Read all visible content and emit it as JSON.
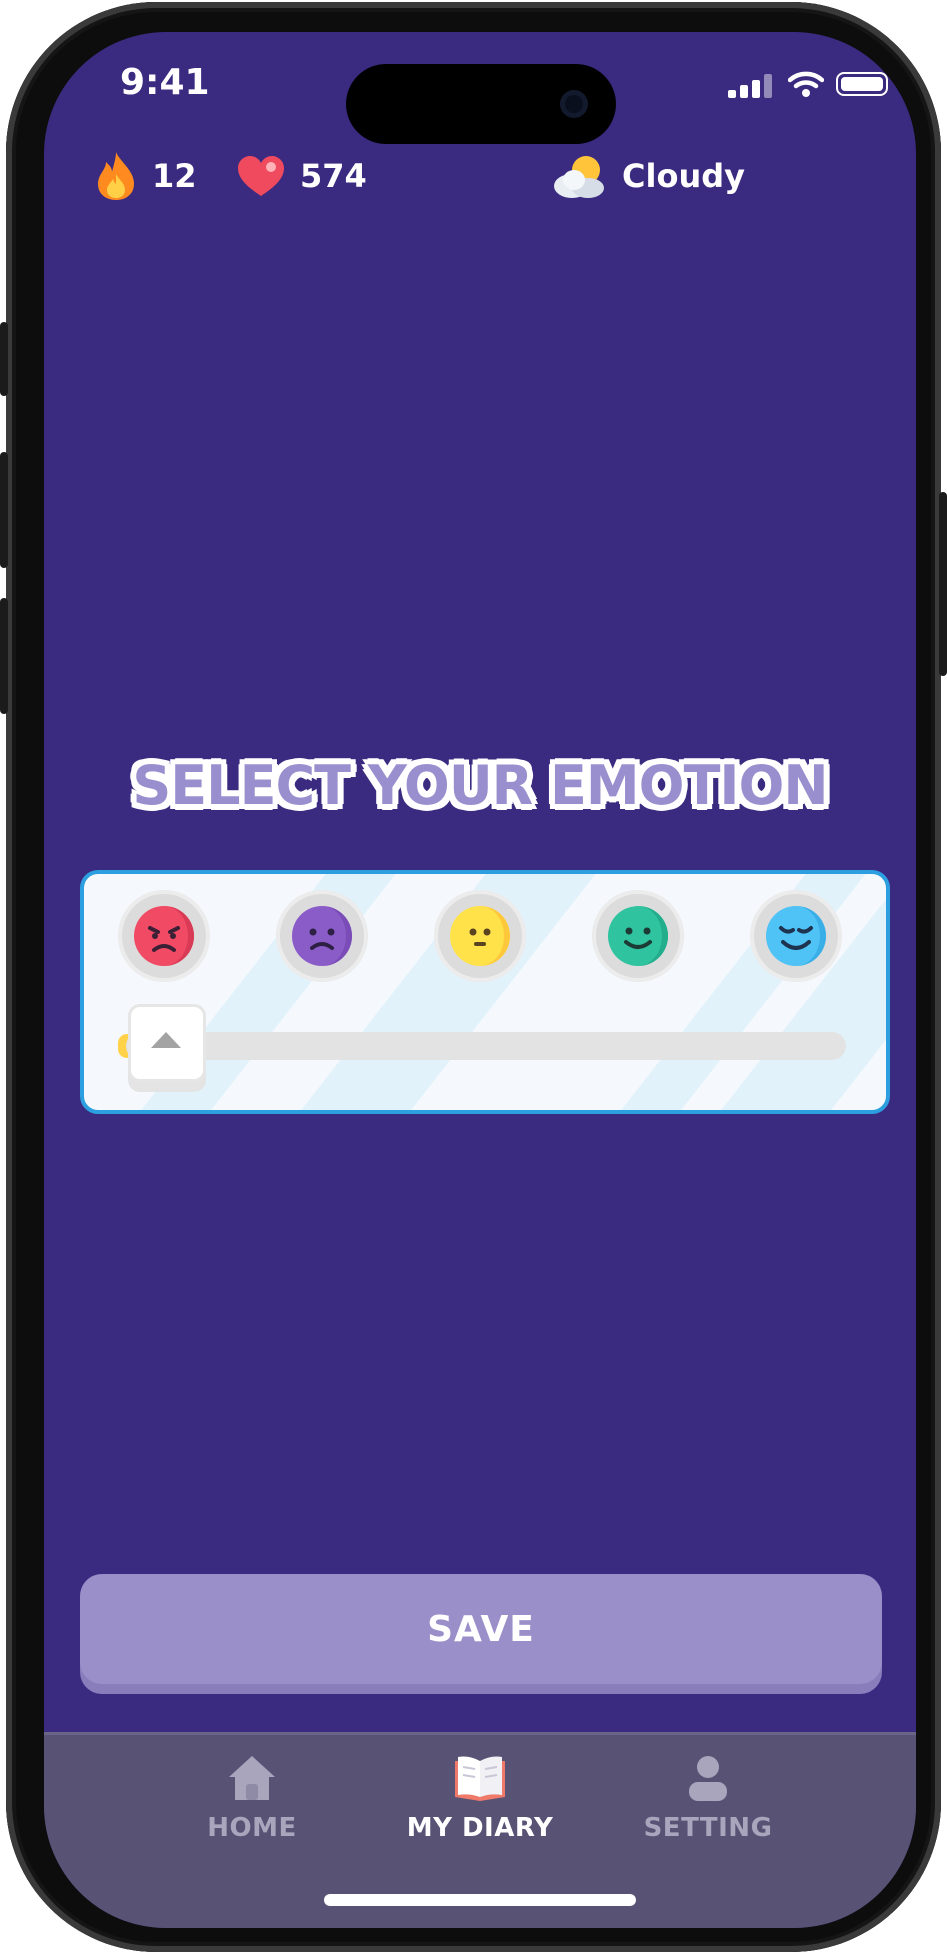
{
  "status_bar": {
    "time": "9:41"
  },
  "header": {
    "streak_count": "12",
    "hearts_count": "574",
    "weather_label": "Cloudy"
  },
  "emotion_picker": {
    "title": "SELECT YOUR EMOTION",
    "options": [
      {
        "name": "angry",
        "color": "#f04a64"
      },
      {
        "name": "sad",
        "color": "#8a5cc8"
      },
      {
        "name": "neutral",
        "color": "#ffe14a"
      },
      {
        "name": "happy",
        "color": "#2fc3a0"
      },
      {
        "name": "very-happy",
        "color": "#4fc3f5"
      }
    ],
    "selected_index": 0
  },
  "actions": {
    "save_label": "SAVE"
  },
  "tabs": [
    {
      "label": "HOME",
      "icon": "home-icon",
      "active": false
    },
    {
      "label": "MY DIARY",
      "icon": "book-icon",
      "active": true
    },
    {
      "label": "SETTING",
      "icon": "user-icon",
      "active": false
    }
  ],
  "colors": {
    "background": "#3a2b80",
    "accent": "#2b9fe0",
    "button": "#9a8fc9",
    "tabbar": "#585274"
  }
}
